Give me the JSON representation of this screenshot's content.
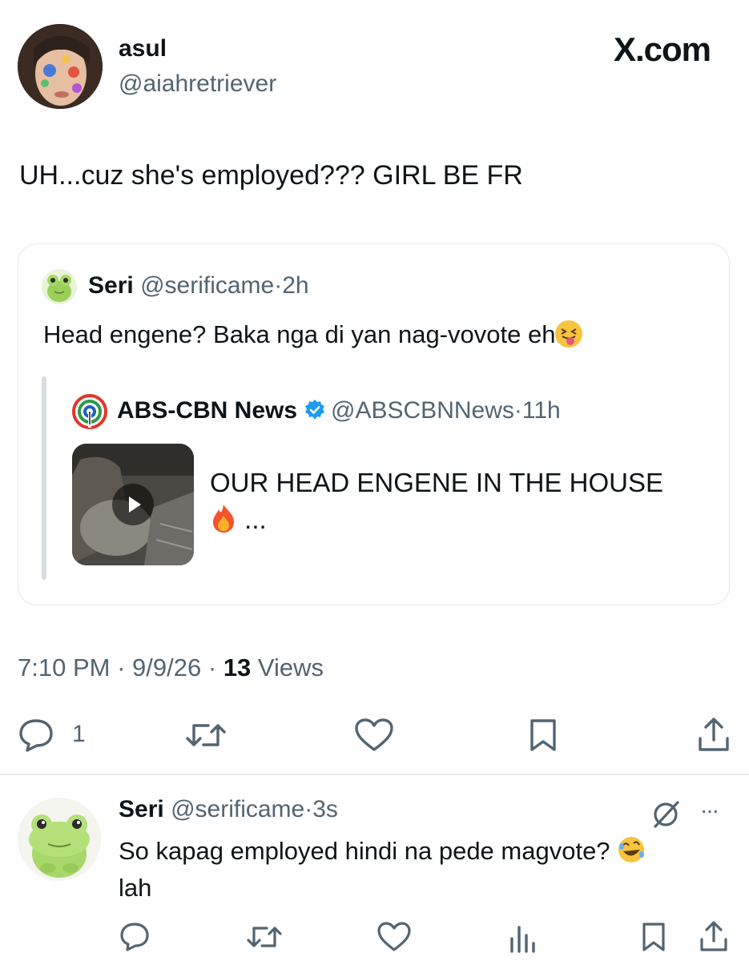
{
  "tweet": {
    "display_name": "asul",
    "handle": "@aiahretriever",
    "brand": "X.com",
    "text": "UH...cuz she's employed??? GIRL BE FR",
    "time": "7:10 PM",
    "date": "9/9/26",
    "views_count": "13",
    "views_label": "Views",
    "reply_count": "1",
    "separator": "·"
  },
  "quote": {
    "display_name": "Seri",
    "handle": "@serificame",
    "age": "2h",
    "text": "Head engene? Baka nga di yan nag-vovote eh",
    "text_emoji": "squinting-tongue-emoji"
  },
  "inner_quote": {
    "display_name": "ABS-CBN News",
    "handle": "@ABSCBNNews",
    "age": "11h",
    "text_line1": "OUR HEAD ENGENE IN THE HOUSE",
    "text_line2": "...",
    "text_emoji": "fire-emoji",
    "verified_color": "#1d9bf0"
  },
  "reply": {
    "display_name": "Seri",
    "handle": "@serificame",
    "age": "3s",
    "text_line1": "So kapag employed hindi na pede magvote?",
    "text_line2": "lah",
    "text_emoji": "rolling-laughing-emoji",
    "more": "···"
  },
  "colors": {
    "text": "#0f1419",
    "muted": "#536471",
    "border": "#e6e9ec"
  }
}
